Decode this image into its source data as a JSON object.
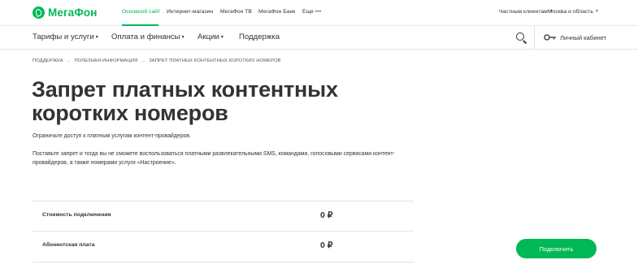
{
  "brand": {
    "logo_text": "МегаФон",
    "accent_color": "#00b956"
  },
  "top_bar": {
    "links": [
      {
        "label": "Основной сайт",
        "active": true
      },
      {
        "label": "Интернет-магазин"
      },
      {
        "label": "МегаФон ТВ"
      },
      {
        "label": "МегаФон Банк"
      },
      {
        "label": "Еще"
      }
    ],
    "more_dots": "•••",
    "audience": "Частным клиентам",
    "region": "Москва и область"
  },
  "main_nav": {
    "items": [
      {
        "label": "Тарифы и услуги",
        "has_dropdown": true
      },
      {
        "label": "Оплата и финансы",
        "has_dropdown": true
      },
      {
        "label": "Акции",
        "has_dropdown": true
      },
      {
        "label": "Поддержка",
        "has_dropdown": false
      }
    ],
    "search_icon": "search-icon",
    "cabinet_icon": "key-icon",
    "cabinet_label": "Личный кабинет"
  },
  "breadcrumb": {
    "items": [
      "Поддержка",
      "Полезная информация",
      "Запрет платных контентных коротких номеров"
    ],
    "separator": "→"
  },
  "page": {
    "title": "Запрет платных контентных коротких номеров",
    "lead": "Ограничьте доступ к платным услугам контент-провайдеров.",
    "description": "Поставьте запрет и тогда вы не сможете воспользоваться платными развлекательными SMS, командами, голосовыми сервисами контент-провайдеров, а также номерами услуги «Настроение»."
  },
  "prices": [
    {
      "label": "Стоимость подключения",
      "value": "0 ₽"
    },
    {
      "label": "Абонентская плата",
      "value": "0 ₽"
    }
  ],
  "connect_button": {
    "label": "Подключить"
  }
}
